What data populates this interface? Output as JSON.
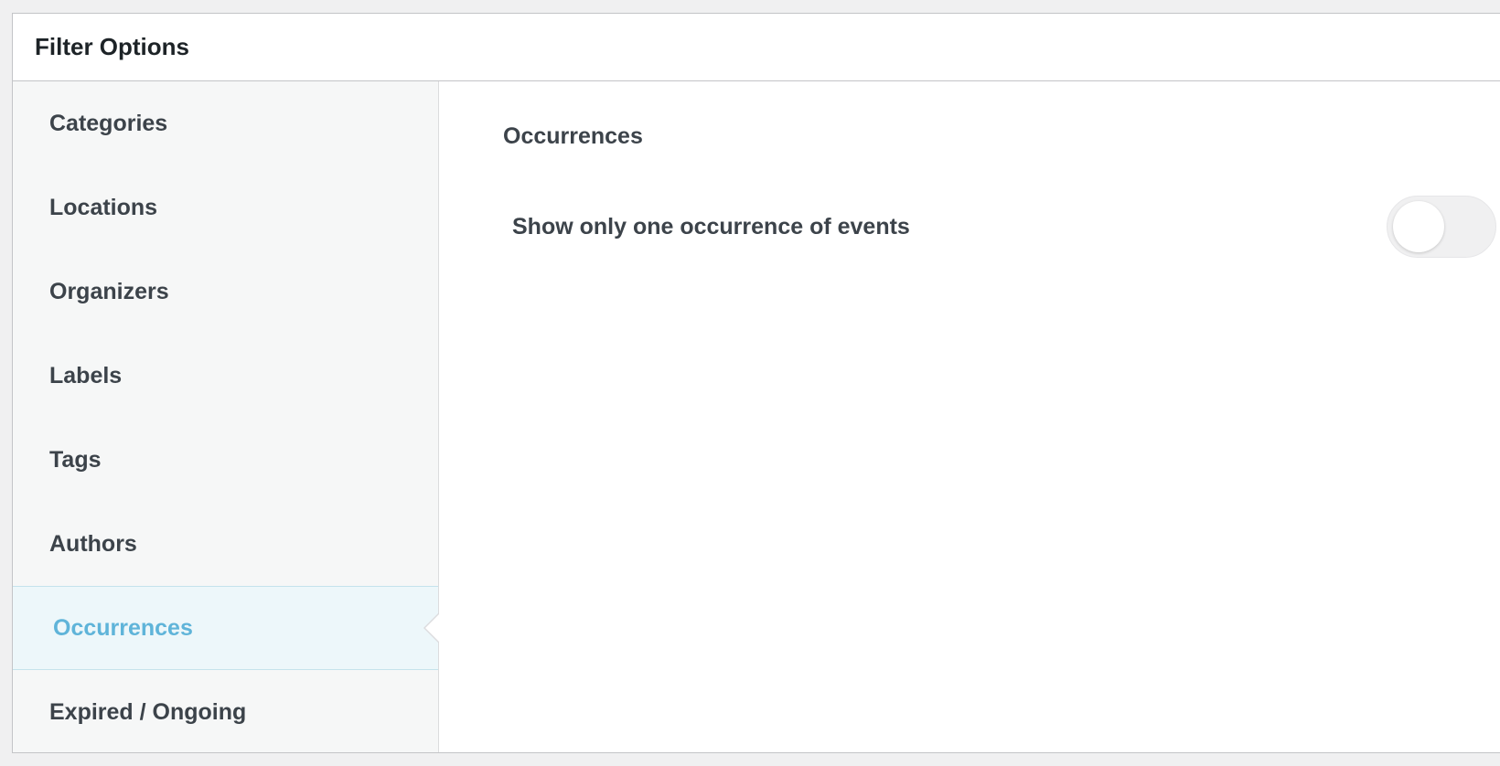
{
  "panel": {
    "title": "Filter Options"
  },
  "sidebar": {
    "items": [
      {
        "label": "Categories"
      },
      {
        "label": "Locations"
      },
      {
        "label": "Organizers"
      },
      {
        "label": "Labels"
      },
      {
        "label": "Tags"
      },
      {
        "label": "Authors"
      },
      {
        "label": "Occurrences"
      },
      {
        "label": "Expired / Ongoing"
      }
    ],
    "active_item": "Occurrences"
  },
  "content": {
    "section_title": "Occurrences",
    "options": [
      {
        "label": "Show only one occurrence of events",
        "enabled": false
      }
    ]
  },
  "colors": {
    "active_text": "#5fb4d9",
    "active_bg": "#edf7fa",
    "sidebar_bg": "#f6f7f7",
    "text": "#3c434a"
  }
}
